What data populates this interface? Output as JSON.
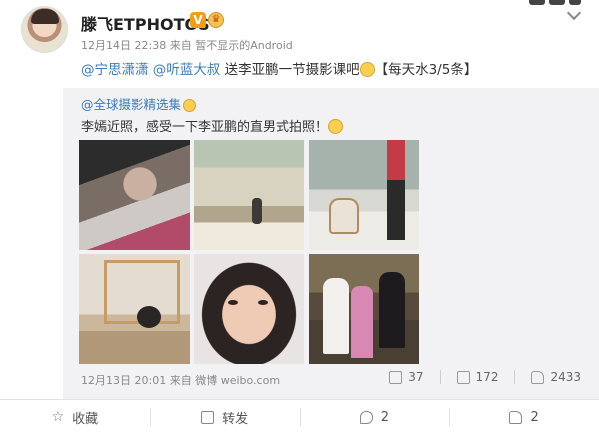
{
  "post": {
    "username": "滕飞ETPHOTOS",
    "verified_badge": "V",
    "time": "12月14日 22:38",
    "source_prefix": "来自",
    "source": "暂不显示的Android",
    "mention1": "@宁思潇潇",
    "mention2": "@听蓝大叔",
    "text": "送李亚鹏一节摄影课吧",
    "tag": "【每天水3/5条】"
  },
  "quoted": {
    "username": "@全球摄影精选集",
    "text": "李嫣近照，感受一下李亚鹏的直男式拍照！",
    "time": "12月13日 20:01",
    "source_prefix": "来自",
    "source": "微博 weibo.com",
    "reposts": "37",
    "comments": "172",
    "likes": "2433"
  },
  "actions": {
    "favorite": "收藏",
    "repost": "转发",
    "comment": "2",
    "like": "2"
  },
  "icons": [
    "star-icon",
    "repost-icon",
    "comment-icon",
    "like-icon",
    "chevron-down-icon"
  ]
}
